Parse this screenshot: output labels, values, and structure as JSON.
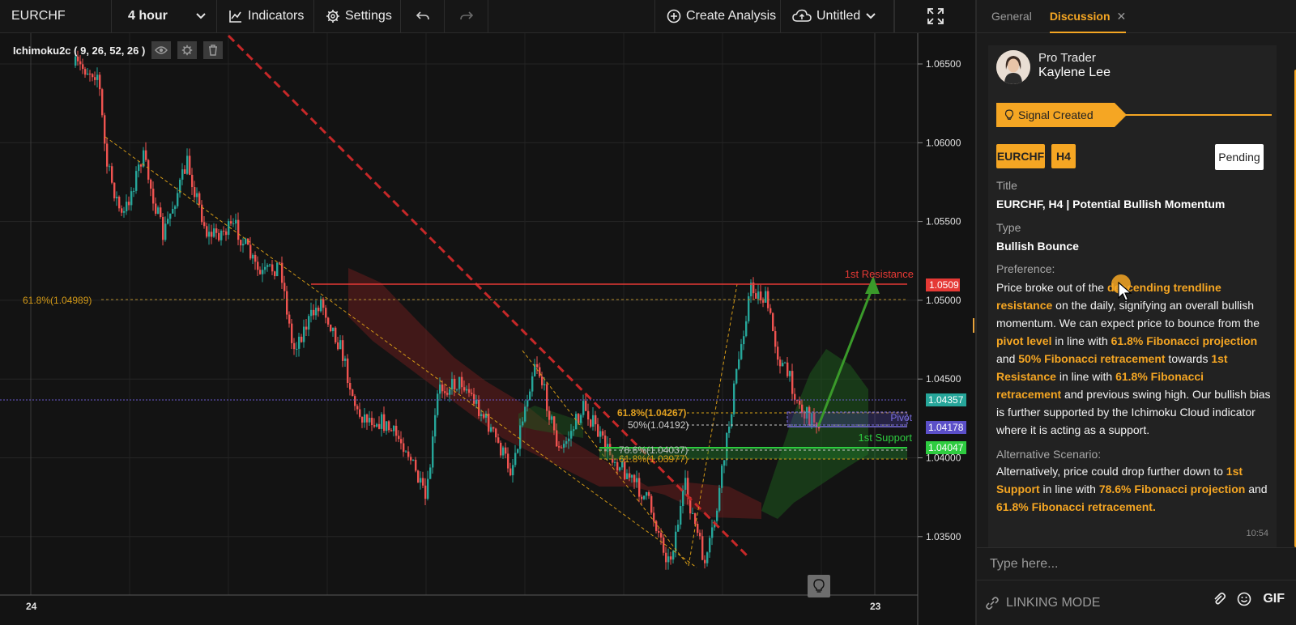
{
  "toolbar": {
    "symbol": "EURCHF",
    "interval": "4 hour",
    "indicators_label": "Indicators",
    "settings_label": "Settings",
    "create_analysis_label": "Create Analysis",
    "layout_name": "Untitled",
    "icons": [
      "chevron-down-icon",
      "indicators-icon",
      "gear-icon",
      "undo-icon",
      "redo-icon",
      "plus-circle-icon",
      "cloud-upload-icon",
      "fullscreen-icon"
    ]
  },
  "indicator_legend": {
    "name": "Ichimoku2c",
    "params": "( 9, 26, 52, 26 )",
    "icons": [
      "eye-icon",
      "gear-icon",
      "trash-icon"
    ]
  },
  "chart": {
    "price_axis": [
      "1.06500",
      "1.06000",
      "1.05500",
      "1.05000",
      "1.04500",
      "1.04000",
      "1.03500"
    ],
    "time_axis": [
      "24",
      "23"
    ],
    "price_badges": {
      "resistance": "1.0509",
      "current": "1.04357",
      "pivot": "1.04178",
      "support": "1.04047"
    },
    "labels": {
      "resistance": "1st Resistance",
      "support": "1st Support",
      "pivot": "Pivot",
      "fib_618_left": "61.8%(1.04989)",
      "fib_618_proj": "61.8%(1.04267)",
      "fib_50": "50%(1.04192)",
      "fib_786": "78.6%(1.04037)",
      "fib_618_ret": "61.8%(1.03977)"
    },
    "colors": {
      "bull": "#26a69a",
      "bear": "#ef5350",
      "resistance": "#e53935",
      "support": "#2ecc40",
      "fib": "#d4a017",
      "pivot": "#6a5acd",
      "trendline": "#c62828"
    }
  },
  "panel": {
    "tabs": [
      "General",
      "Discussion"
    ],
    "author_role": "Pro Trader",
    "author_name": "Kaylene Lee",
    "signal_label": "Signal Created",
    "symbol_tag": "EURCHF",
    "interval_tag": "H4",
    "status": "Pending",
    "title_label": "Title",
    "title_value": "EURCHF, H4 | Potential Bullish Momentum",
    "type_label": "Type",
    "type_value": "Bullish Bounce",
    "preference_label": "Preference:",
    "preference_segments": [
      {
        "t": "Price broke out of the ",
        "h": false
      },
      {
        "t": "descending trendline resistance",
        "h": true
      },
      {
        "t": " on the daily, signifying an overall bullish momentum. We can expect price to bounce from the ",
        "h": false
      },
      {
        "t": "pivot level",
        "h": true
      },
      {
        "t": " in line with ",
        "h": false
      },
      {
        "t": "61.8% Fibonacci projection",
        "h": true
      },
      {
        "t": " and ",
        "h": false
      },
      {
        "t": "50% Fibonacci retracement",
        "h": true
      },
      {
        "t": " towards ",
        "h": false
      },
      {
        "t": "1st Resistance",
        "h": true
      },
      {
        "t": " in line with ",
        "h": false
      },
      {
        "t": "61.8% Fibonacci retracement",
        "h": true
      },
      {
        "t": " and previous swing high. Our bullish bias is further supported by the Ichimoku Cloud indicator where it is acting as a support.",
        "h": false
      }
    ],
    "alternative_label": "Alternative Scenario:",
    "alternative_segments": [
      {
        "t": "Alternatively, price could drop further down to ",
        "h": false
      },
      {
        "t": "1st Support",
        "h": true
      },
      {
        "t": " in line with ",
        "h": false
      },
      {
        "t": "78.6% Fibonacci projection",
        "h": true
      },
      {
        "t": " and ",
        "h": false
      },
      {
        "t": "61.8% Fibonacci retracement.",
        "h": true
      }
    ],
    "time": "10:54",
    "input_placeholder": "Type here...",
    "linking_mode": "LINKING MODE",
    "gif_label": "GIF"
  }
}
